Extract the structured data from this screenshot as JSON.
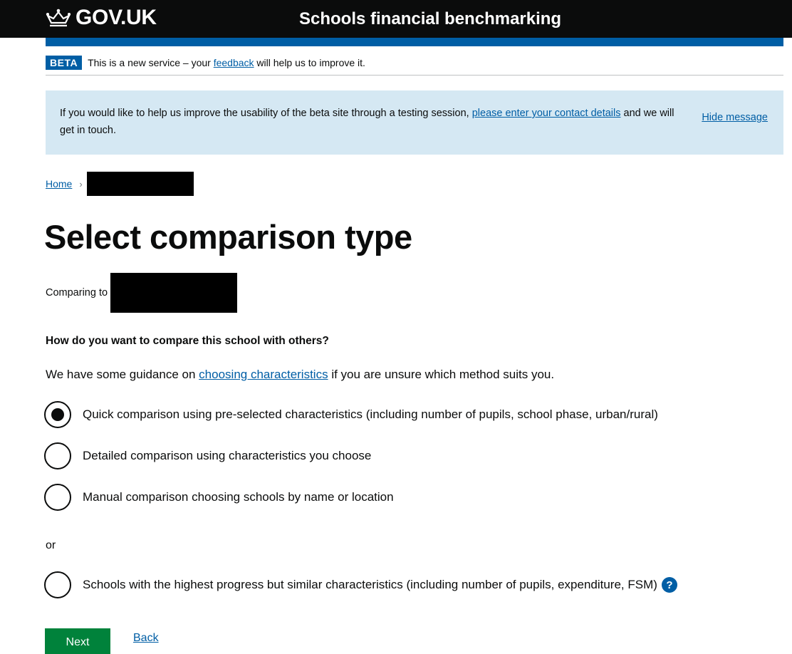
{
  "header": {
    "logo_text": "GOV.UK",
    "service_name": "Schools financial benchmarking"
  },
  "beta_banner": {
    "tag": "BETA",
    "text_before": "This is a new service – your",
    "link": "feedback",
    "text_after": "will help us to improve it."
  },
  "info_banner": {
    "text_before": "If you would like to help us improve the usability of the beta site through a testing session,",
    "link": "please enter your contact details",
    "text_after": "and we will get in touch.",
    "hide_label": "Hide message"
  },
  "breadcrumb": {
    "home": "Home",
    "separator": "›"
  },
  "page": {
    "title": "Select comparison type",
    "comparing_label": "Comparing to",
    "question": "How do you want to compare this school with others?",
    "guidance_before": "We have some guidance on",
    "guidance_link": "choosing characteristics",
    "guidance_after": "if you are unsure which method suits you.",
    "or_label": "or"
  },
  "options": [
    {
      "label": "Quick comparison using pre-selected characteristics (including number of pupils, school phase, urban/rural)",
      "selected": true
    },
    {
      "label": "Detailed comparison using characteristics you choose",
      "selected": false
    },
    {
      "label": "Manual comparison choosing schools by name or location",
      "selected": false
    },
    {
      "label": "Schools with the highest progress but similar characteristics (including number of pupils, expenditure, FSM)",
      "selected": false
    }
  ],
  "help_icon_glyph": "?",
  "actions": {
    "next": "Next",
    "back": "Back"
  },
  "colors": {
    "header_bg": "#0b0c0c",
    "brand_blue": "#005ea5",
    "info_bg": "#d5e8f3",
    "button_green": "#00823b"
  }
}
